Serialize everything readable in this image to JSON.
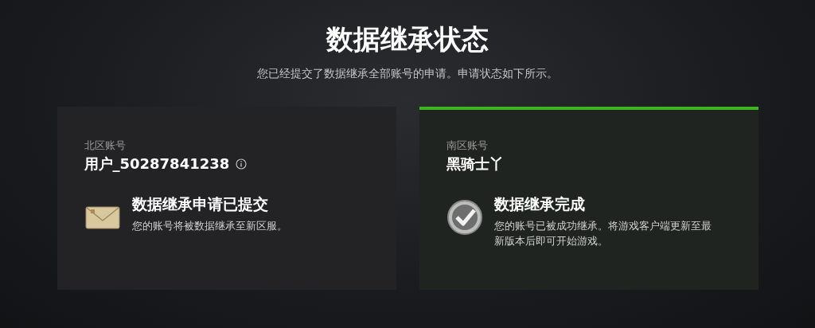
{
  "title": "数据继承状态",
  "subtitle": "您已经提交了数据继承全部账号的申请。申请状态如下所示。",
  "cards": [
    {
      "kind": "pending",
      "region": "北区账号",
      "account": "用户_50287841238",
      "info_icon": true,
      "status": "数据继承申请已提交",
      "description": "您的账号将被数据继承至新区服。"
    },
    {
      "kind": "complete",
      "region": "南区账号",
      "account": "黑骑士丫",
      "info_icon": false,
      "status": "数据继承完成",
      "description": "您的账号已被成功继承。将游戏客户端更新至最新版本后即可开始游戏。"
    }
  ]
}
